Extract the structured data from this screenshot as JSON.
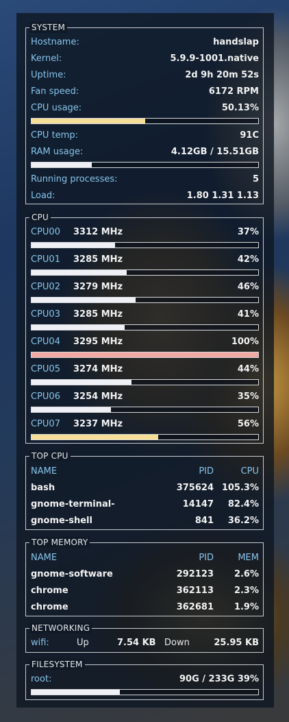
{
  "system": {
    "title": "SYSTEM",
    "hostname_label": "Hostname:",
    "hostname": "handslap",
    "kernel_label": "Kernel:",
    "kernel": "5.9.9-1001.native",
    "uptime_label": "Uptime:",
    "uptime": "2d 9h 20m 52s",
    "fan_label": "Fan speed:",
    "fan": "6172 RPM",
    "cpu_usage_label": "CPU usage:",
    "cpu_usage": "50.13%",
    "cpu_usage_level": 0.5013,
    "cpu_temp_label": "CPU temp:",
    "cpu_temp": "91C",
    "ram_label": "RAM usage:",
    "ram": "4.12GB / 15.51GB",
    "ram_level": 0.266,
    "proc_label": "Running processes:",
    "proc": "5",
    "load_label": "Load:",
    "load": "1.80 1.31 1.13"
  },
  "cpu": {
    "title": "CPU",
    "cores": [
      {
        "name": "CPU00",
        "mhz": "3312 MHz",
        "pct": "37%",
        "level": 0.37,
        "color": "#eef0f6"
      },
      {
        "name": "CPU01",
        "mhz": "3285 MHz",
        "pct": "42%",
        "level": 0.42,
        "color": "#eef0f6"
      },
      {
        "name": "CPU02",
        "mhz": "3279 MHz",
        "pct": "46%",
        "level": 0.46,
        "color": "#eef0f6"
      },
      {
        "name": "CPU03",
        "mhz": "3285 MHz",
        "pct": "41%",
        "level": 0.41,
        "color": "#eef0f6"
      },
      {
        "name": "CPU04",
        "mhz": "3295 MHz",
        "pct": "100%",
        "level": 1.0,
        "color": "#f3a9a3"
      },
      {
        "name": "CPU05",
        "mhz": "3274 MHz",
        "pct": "44%",
        "level": 0.44,
        "color": "#eef0f6"
      },
      {
        "name": "CPU06",
        "mhz": "3254 MHz",
        "pct": "35%",
        "level": 0.35,
        "color": "#eef0f6"
      },
      {
        "name": "CPU07",
        "mhz": "3237 MHz",
        "pct": "56%",
        "level": 0.56,
        "color": "#f6de96"
      }
    ]
  },
  "top_cpu": {
    "title": "TOP CPU",
    "headers": {
      "name": "NAME",
      "pid": "PID",
      "value": "CPU"
    },
    "rows": [
      {
        "name": "bash",
        "pid": "375624",
        "value": "105.3%"
      },
      {
        "name": "gnome-terminal-",
        "pid": "14147",
        "value": "82.4%"
      },
      {
        "name": "gnome-shell",
        "pid": "841",
        "value": "36.2%"
      }
    ]
  },
  "top_mem": {
    "title": "TOP MEMORY",
    "headers": {
      "name": "NAME",
      "pid": "PID",
      "value": "MEM"
    },
    "rows": [
      {
        "name": "gnome-software",
        "pid": "292123",
        "value": "2.6%"
      },
      {
        "name": "chrome",
        "pid": "362113",
        "value": "2.3%"
      },
      {
        "name": "chrome",
        "pid": "362681",
        "value": "1.9%"
      }
    ]
  },
  "net": {
    "title": "NETWORKING",
    "iface": "wifi:",
    "up_label": "Up",
    "up": "7.54 KB",
    "down_label": "Down",
    "down": "25.95 KB"
  },
  "fs": {
    "title": "FILESYSTEM",
    "mount": "root:",
    "usage": "90G / 233G 39%",
    "level": 0.39
  }
}
